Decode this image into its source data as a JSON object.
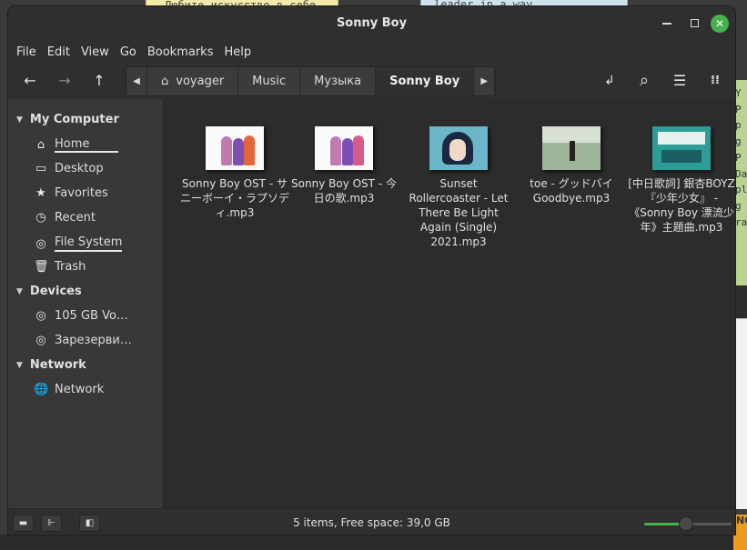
{
  "desktop": {
    "note_yellow_text": "Любите искусство в себе.",
    "note_blue_text": "leader in a way",
    "note_green_lines": [
      "Y",
      "P",
      "p",
      "g",
      "P",
      "Da",
      "pl",
      "g",
      "ra"
    ],
    "orange_text": "NC"
  },
  "window": {
    "title": "Sonny Boy",
    "close_glyph": "✕"
  },
  "menu": [
    "File",
    "Edit",
    "View",
    "Go",
    "Bookmarks",
    "Help"
  ],
  "toolbar": {
    "back_glyph": "←",
    "forward_glyph": "→",
    "up_glyph": "↑",
    "breadcrumbs": [
      "voyager",
      "Music",
      "Музыка",
      "Sonny Boy"
    ],
    "path_left_glyph": "◀",
    "path_right_glyph": "▶",
    "home_glyph": "⌂",
    "location_glyph": "↲",
    "search_glyph": "⌕",
    "list_view_glyph": "☰",
    "compact_view_glyph": "⁞⁞"
  },
  "sidebar": {
    "sections": [
      {
        "title": "My Computer",
        "tri": "▼"
      },
      {
        "title": "Devices",
        "tri": "▼"
      },
      {
        "title": "Network",
        "tri": "▼"
      }
    ],
    "my_computer": [
      {
        "label": "Home",
        "icon": "⌂"
      },
      {
        "label": "Desktop",
        "icon": "▭"
      },
      {
        "label": "Favorites",
        "icon": "★"
      },
      {
        "label": "Recent",
        "icon": "◷"
      },
      {
        "label": "File System",
        "icon": "◎"
      },
      {
        "label": "Trash",
        "icon": "🗑"
      }
    ],
    "devices": [
      {
        "label": "105 GB Vo…",
        "icon": "◎"
      },
      {
        "label": "Зарезерви…",
        "icon": "◎"
      }
    ],
    "network": [
      {
        "label": "Network",
        "icon": "🌐"
      }
    ]
  },
  "files": [
    {
      "name": "Sonny Boy OST - サニーボーイ・ラプソディ.mp3"
    },
    {
      "name": "Sonny Boy OST - 今日の歌.mp3"
    },
    {
      "name": "Sunset Rollercoaster - Let There Be Light Again (Single) 2021.mp3"
    },
    {
      "name": "toe - グッドバイ Goodbye.mp3"
    },
    {
      "name": "[中日歌詞] 銀杏BOYZ『少年少女』 - 《Sonny Boy 漂流少年》主題曲.mp3"
    }
  ],
  "statusbar": {
    "text": "5 items, Free space: 39,0 GB",
    "zoom_level": 0.48,
    "btn1_glyph": "▬",
    "btn2_glyph": "⊩",
    "btn3_glyph": "◧"
  }
}
